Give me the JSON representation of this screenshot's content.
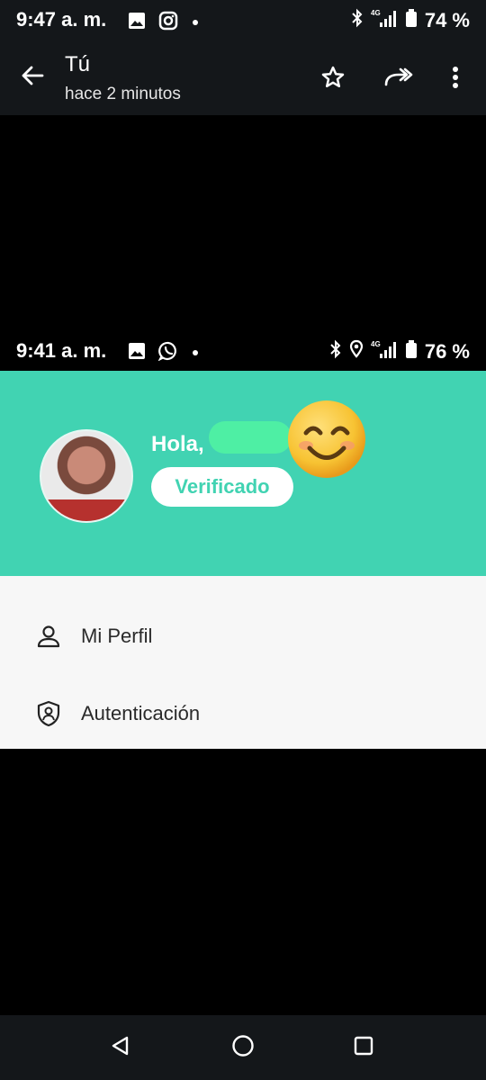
{
  "outer_status": {
    "time": "9:47 a. m.",
    "battery": "74 %",
    "icons": [
      "gallery-icon",
      "instagram-icon",
      "dot-icon",
      "bluetooth-icon",
      "signal-4g-icon",
      "battery-icon"
    ]
  },
  "viewer": {
    "title": "Tú",
    "subtitle": "hace 2 minutos",
    "actions": [
      "back-arrow-icon",
      "star-icon",
      "forward-icon",
      "more-vert-icon"
    ]
  },
  "inner_status": {
    "time": "9:41 a. m.",
    "battery": "76 %",
    "icons": [
      "gallery-icon",
      "whatsapp-icon",
      "dot-icon",
      "bluetooth-icon",
      "location-icon",
      "signal-4g-icon",
      "battery-icon"
    ]
  },
  "profile": {
    "greeting": "Hola,",
    "verified_label": "Verificado",
    "emoji": "smiling-face-icon"
  },
  "menu": {
    "items": [
      {
        "label": "Mi Perfil",
        "icon": "person-icon"
      },
      {
        "label": "Autenticación",
        "icon": "shield-user-icon"
      }
    ]
  },
  "nav": {
    "buttons": [
      "back-triangle-icon",
      "home-circle-icon",
      "recents-square-icon"
    ]
  },
  "colors": {
    "accent": "#41d3b2",
    "bar": "#14171a",
    "menu_bg": "#f7f7f7"
  }
}
